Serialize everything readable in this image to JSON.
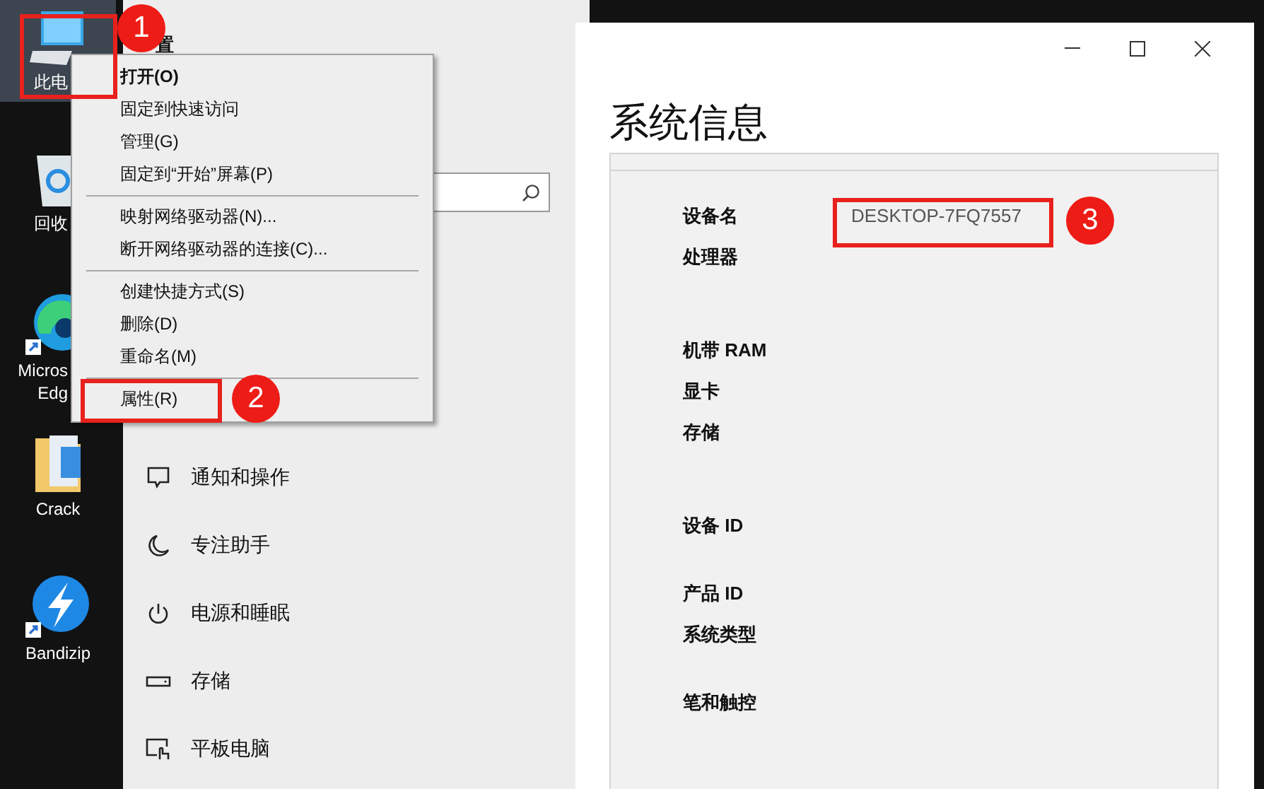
{
  "desktop_icons": [
    {
      "kind": "computer",
      "label": "此电",
      "selected": true
    },
    {
      "kind": "recycle",
      "label": "回收",
      "selected": false
    },
    {
      "kind": "edge",
      "label": "Micros\nEdg",
      "selected": false
    },
    {
      "kind": "folder",
      "label": "Crack",
      "selected": false
    },
    {
      "kind": "bandizip",
      "label": "Bandizip",
      "selected": false
    }
  ],
  "settings_window": {
    "heading": "置",
    "nav_items": [
      {
        "kind": "notify",
        "label": "通知和操作"
      },
      {
        "kind": "focus",
        "label": "专注助手"
      },
      {
        "kind": "power",
        "label": "电源和睡眠"
      },
      {
        "kind": "storage",
        "label": "存储"
      },
      {
        "kind": "tablet",
        "label": "平板电脑"
      }
    ]
  },
  "context_menu": [
    {
      "kind": "item",
      "label": "打开(O)",
      "default": true
    },
    {
      "kind": "item",
      "label": "固定到快速访问",
      "default": false
    },
    {
      "kind": "item",
      "label": "管理(G)",
      "default": false
    },
    {
      "kind": "item",
      "label": "固定到“开始”屏幕(P)",
      "default": false
    },
    {
      "kind": "separator"
    },
    {
      "kind": "item",
      "label": "映射网络驱动器(N)...",
      "default": false
    },
    {
      "kind": "item",
      "label": "断开网络驱动器的连接(C)...",
      "default": false
    },
    {
      "kind": "separator"
    },
    {
      "kind": "item",
      "label": "创建快捷方式(S)",
      "default": false
    },
    {
      "kind": "item",
      "label": "删除(D)",
      "default": false
    },
    {
      "kind": "item",
      "label": "重命名(M)",
      "default": false
    },
    {
      "kind": "separator"
    },
    {
      "kind": "item",
      "label": "属性(R)",
      "default": false
    }
  ],
  "system_window": {
    "title": "系统信息",
    "rows": [
      {
        "label": "设备名",
        "value": "DESKTOP-7FQ7557"
      },
      {
        "label": "处理器"
      },
      {
        "label": "机带 RAM"
      },
      {
        "label": "显卡"
      },
      {
        "label": "存储"
      },
      {
        "label": "设备 ID"
      },
      {
        "label": "产品 ID"
      },
      {
        "label": "系统类型"
      },
      {
        "label": "笔和触控"
      }
    ]
  },
  "annotations": [
    {
      "label": "1"
    },
    {
      "label": "2"
    },
    {
      "label": "3"
    }
  ]
}
